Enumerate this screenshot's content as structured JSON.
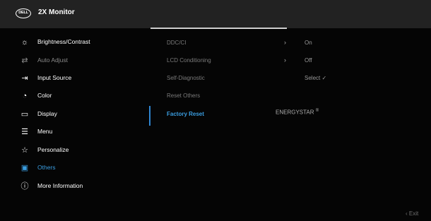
{
  "header": {
    "logo_text": "DELL",
    "title": "2X Monitor"
  },
  "menu": {
    "items": [
      {
        "label": "Brightness/Contrast",
        "icon": "sun-icon",
        "glyph": "☼",
        "state": "normal"
      },
      {
        "label": "Auto Adjust",
        "icon": "auto-adjust-icon",
        "glyph": "⇄",
        "state": "dim"
      },
      {
        "label": "Input Source",
        "icon": "input-source-icon",
        "glyph": "⇥",
        "state": "normal"
      },
      {
        "label": "Color",
        "icon": "palette-icon",
        "glyph": "◔",
        "state": "normal"
      },
      {
        "label": "Display",
        "icon": "display-icon",
        "glyph": "▭",
        "state": "normal"
      },
      {
        "label": "Menu",
        "icon": "menu-icon",
        "glyph": "☰",
        "state": "normal"
      },
      {
        "label": "Personalize",
        "icon": "star-icon",
        "glyph": "☆",
        "state": "normal"
      },
      {
        "label": "Others",
        "icon": "others-icon",
        "glyph": "▣",
        "state": "active"
      },
      {
        "label": "More Information",
        "icon": "info-icon",
        "glyph": "ⓘ",
        "state": "normal"
      }
    ]
  },
  "submenu": {
    "items": [
      {
        "label": "DDC/CI",
        "chevron": "›",
        "value": "On"
      },
      {
        "label": "LCD Conditioning",
        "chevron": "›",
        "value": "Off"
      },
      {
        "label": "Self-Diagnostic",
        "value": "Select ✓"
      },
      {
        "label": "Reset Others"
      },
      {
        "label": "Factory Reset",
        "active": true
      }
    ],
    "energystar_label": "ENERGYSTAR",
    "energystar_mark": "®"
  },
  "footer": {
    "exit_label": "‹  Exit"
  },
  "colors": {
    "accent": "#3a9de0",
    "header_bg": "#222222"
  }
}
